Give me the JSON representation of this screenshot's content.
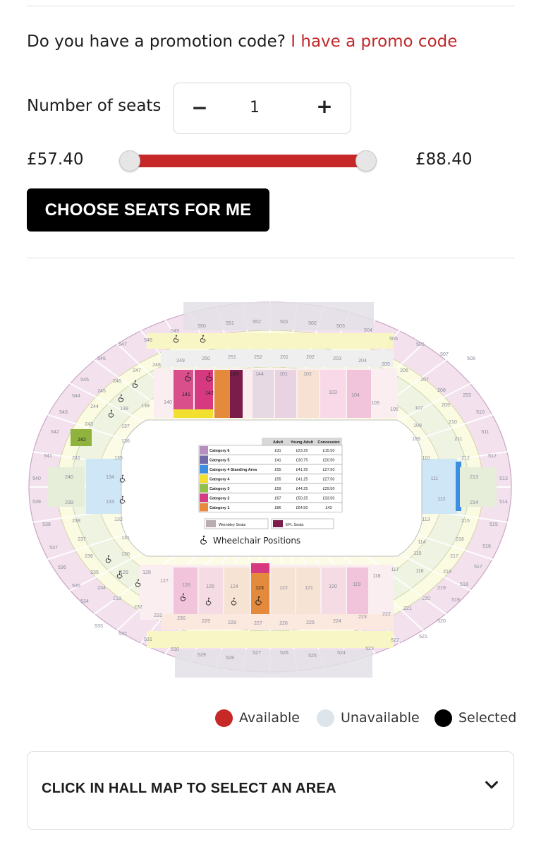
{
  "promo": {
    "question": "Do you have a promotion code?",
    "link": "I have a promo code"
  },
  "seats": {
    "label": "Number of seats",
    "minus": "−",
    "plus": "+",
    "value": "1"
  },
  "price": {
    "min": "£57.40",
    "max": "£88.40"
  },
  "choose_button": "CHOOSE SEATS FOR ME",
  "stadium_map": {
    "icon": "wheelchair-icon",
    "top_block_labels": [
      "547",
      "548",
      "549",
      "550",
      "551",
      "552",
      "501",
      "502",
      "503",
      "504",
      "505",
      "506",
      "507"
    ],
    "upper_labels": [
      "247",
      "248",
      "249",
      "250",
      "251",
      "252",
      "201",
      "202",
      "203",
      "204",
      "205",
      "206",
      "207",
      "208"
    ],
    "lower_top_labels": [
      "139",
      "140",
      "141",
      "142",
      "143",
      "144",
      "101",
      "102",
      "103",
      "104",
      "105",
      "106",
      "107"
    ],
    "bottom_lower_labels": [
      "129",
      "128",
      "127",
      "126",
      "125",
      "124",
      "123",
      "122",
      "121",
      "120",
      "119",
      "118",
      "117",
      "116"
    ],
    "bottom_upper_labels": [
      "231",
      "230",
      "229",
      "228",
      "227",
      "226",
      "225",
      "224",
      "223",
      "222"
    ],
    "bottom_top_labels": [
      "531",
      "530",
      "529",
      "528",
      "527",
      "526",
      "525",
      "524",
      "523",
      "522"
    ],
    "left_labels": [
      "546",
      "545",
      "544",
      "543",
      "542",
      "541",
      "540",
      "539",
      "538",
      "537",
      "536",
      "535",
      "534",
      "533",
      "532"
    ],
    "left_mid_labels": [
      "246",
      "245",
      "244",
      "243",
      "242",
      "241",
      "240",
      "239",
      "238",
      "237",
      "236",
      "235",
      "234",
      "233",
      "232"
    ],
    "left_inner_labels": [
      "138",
      "137",
      "136",
      "135",
      "134",
      "133",
      "132",
      "131",
      "130"
    ],
    "right_labels": [
      "508",
      "253",
      "510",
      "511",
      "512",
      "513",
      "514",
      "515",
      "516",
      "517",
      "518",
      "519",
      "520",
      "521"
    ],
    "right_mid_labels": [
      "209",
      "210",
      "211",
      "212",
      "213",
      "214",
      "215",
      "216",
      "217",
      "218",
      "219",
      "220",
      "221"
    ],
    "right_inner_labels": [
      "108",
      "109",
      "110",
      "111",
      "112",
      "113",
      "114",
      "115"
    ],
    "price_table": {
      "headers": [
        "Adult",
        "Young Adult",
        "Concession"
      ],
      "rows": [
        {
          "name": "Category 6",
          "color": "#b48fbf",
          "adult": "£31",
          "young": "£23.25",
          "concession": "£15.50"
        },
        {
          "name": "Category 5",
          "color": "#6f6aa8",
          "adult": "£41",
          "young": "£30.75",
          "concession": "£20.50"
        },
        {
          "name": "Category 4 Standing Area",
          "color": "#3a8fe0",
          "adult": "£55",
          "young": "£41.25",
          "concession": "£27.50"
        },
        {
          "name": "Category 4",
          "color": "#f2e030",
          "adult": "£55",
          "young": "£41.25",
          "concession": "£27.50"
        },
        {
          "name": "Category 3",
          "color": "#93c04a",
          "adult": "£59",
          "young": "£44.25",
          "concession": "£29.50"
        },
        {
          "name": "Category 2",
          "color": "#d63c85",
          "adult": "£67",
          "young": "£50.25",
          "concession": "£33.50"
        },
        {
          "name": "Category 1",
          "color": "#e88a3c",
          "adult": "£86",
          "young": "£64.50",
          "concession": "£43"
        }
      ]
    },
    "key": [
      {
        "name": "Wembley Seats",
        "color": "#b9adb1"
      },
      {
        "name": "EFL Seats",
        "color": "#7a1d4a"
      }
    ],
    "wheelchair_label": "Wheelchair Positions"
  },
  "legend": [
    {
      "label": "Available",
      "color": "#c62828"
    },
    {
      "label": "Unavailable",
      "color": "#dde5ea"
    },
    {
      "label": "Selected",
      "color": "#000000"
    }
  ],
  "area_select": {
    "label": "CLICK IN HALL MAP TO SELECT AN AREA",
    "icon": "chevron-down-icon"
  }
}
